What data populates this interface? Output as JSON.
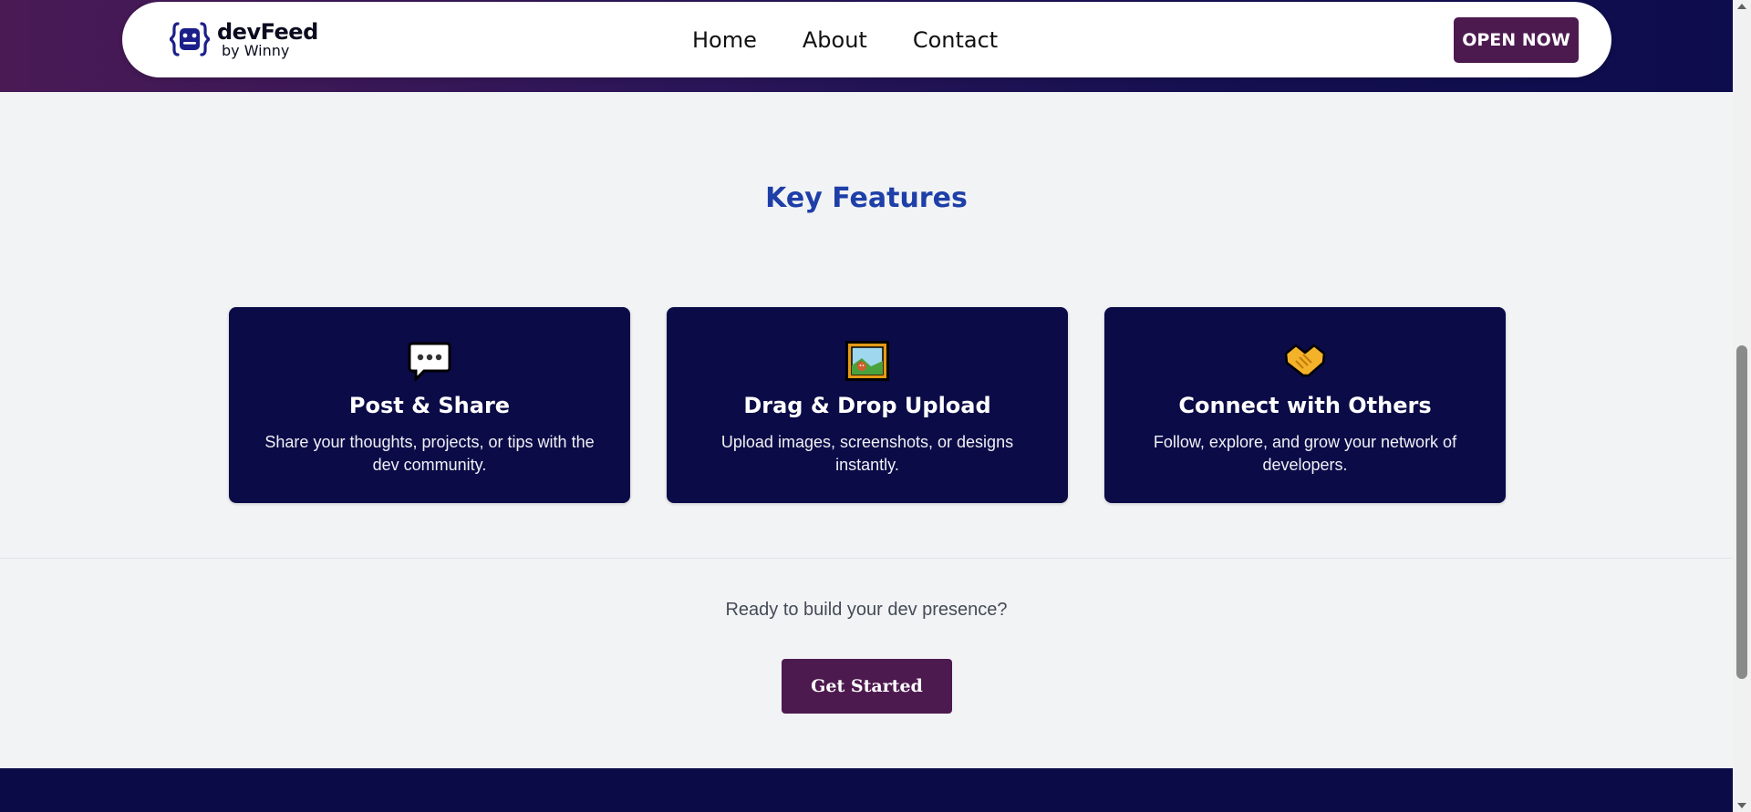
{
  "header": {
    "brand_name": "devFeed",
    "brand_sub": "by Winny",
    "nav": [
      {
        "label": "Home"
      },
      {
        "label": "About"
      },
      {
        "label": "Contact"
      }
    ],
    "open_button": "OPEN NOW"
  },
  "features": {
    "title": "Key Features",
    "cards": [
      {
        "icon": "speech-bubble-icon",
        "title": "Post & Share",
        "desc": "Share your thoughts, projects, or tips with the dev community."
      },
      {
        "icon": "framed-picture-icon",
        "title": "Drag & Drop Upload",
        "desc": "Upload images, screenshots, or designs instantly."
      },
      {
        "icon": "handshake-icon",
        "title": "Connect with Others",
        "desc": "Follow, explore, and grow your network of developers."
      }
    ]
  },
  "cta": {
    "text": "Ready to build your dev presence?",
    "button": "Get Started"
  },
  "colors": {
    "accent_button": "#4d1a4f",
    "card_bg": "#0b0b48",
    "title_blue": "#1e3fa8",
    "page_bg": "#f2f3f5"
  }
}
